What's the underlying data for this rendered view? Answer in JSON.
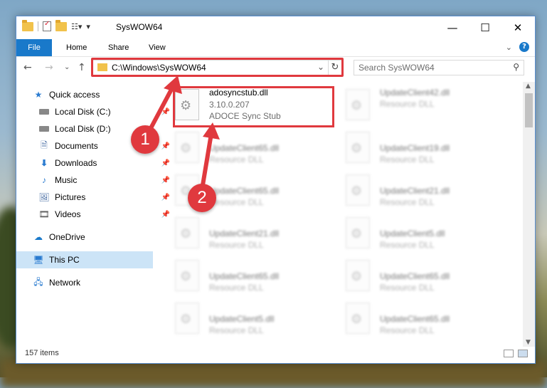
{
  "window": {
    "title": "SysWOW64",
    "controls": {
      "minimize": "—",
      "maximize": "☐",
      "close": "✕"
    }
  },
  "ribbon": {
    "tabs": [
      {
        "label": "File"
      },
      {
        "label": "Home"
      },
      {
        "label": "Share"
      },
      {
        "label": "View"
      }
    ],
    "help": "?"
  },
  "navigation": {
    "address": "C:\\Windows\\SysWOW64",
    "search_placeholder": "Search SysWOW64"
  },
  "sidebar": {
    "items": [
      {
        "label": "Quick access",
        "icon": "star-icon",
        "pinned": false
      },
      {
        "label": "Local Disk (C:)",
        "icon": "drive-icon",
        "pinned": true
      },
      {
        "label": "Local Disk (D:)",
        "icon": "drive-icon",
        "pinned": false
      },
      {
        "label": "Documents",
        "icon": "documents-icon",
        "pinned": true
      },
      {
        "label": "Downloads",
        "icon": "download-icon",
        "pinned": true
      },
      {
        "label": "Music",
        "icon": "music-icon",
        "pinned": true
      },
      {
        "label": "Pictures",
        "icon": "pictures-icon",
        "pinned": true
      },
      {
        "label": "Videos",
        "icon": "videos-icon",
        "pinned": true
      },
      {
        "label": "OneDrive",
        "icon": "cloud-icon",
        "pinned": false
      },
      {
        "label": "This PC",
        "icon": "computer-icon",
        "pinned": false,
        "selected": true
      },
      {
        "label": "Network",
        "icon": "network-icon",
        "pinned": false
      }
    ]
  },
  "files": {
    "highlighted": {
      "name": "adosyncstub.dll",
      "version": "3.10.0.207",
      "description": "ADOCE Sync Stub"
    },
    "right_column": [
      {
        "name": "UpdateClient42.dll",
        "type": "Resource DLL"
      },
      {
        "name": "UpdateClient19.dll",
        "type": "Resource DLL"
      },
      {
        "name": "UpdateClient21.dll",
        "type": "Resource DLL"
      },
      {
        "name": "UpdateClient5.dll",
        "type": "Resource DLL"
      },
      {
        "name": "UpdateClient65.dll",
        "type": "Resource DLL"
      },
      {
        "name": "UpdateClient65.dll",
        "type": "Resource DLL"
      }
    ],
    "left_column": [
      {
        "name": "UpdateClient65.dll",
        "type": "Resource DLL"
      },
      {
        "name": "UpdateClient65.dll",
        "type": "Resource DLL"
      },
      {
        "name": "UpdateClient21.dll",
        "type": "Resource DLL"
      },
      {
        "name": "UpdateClient65.dll",
        "type": "Resource DLL"
      },
      {
        "name": "UpdateClient5.dll",
        "type": "Resource DLL"
      }
    ]
  },
  "status": {
    "item_count": "157 items"
  },
  "annotations": {
    "step1": "1",
    "step2": "2"
  },
  "colors": {
    "accent": "#1979ca",
    "highlight": "#e0393e"
  }
}
